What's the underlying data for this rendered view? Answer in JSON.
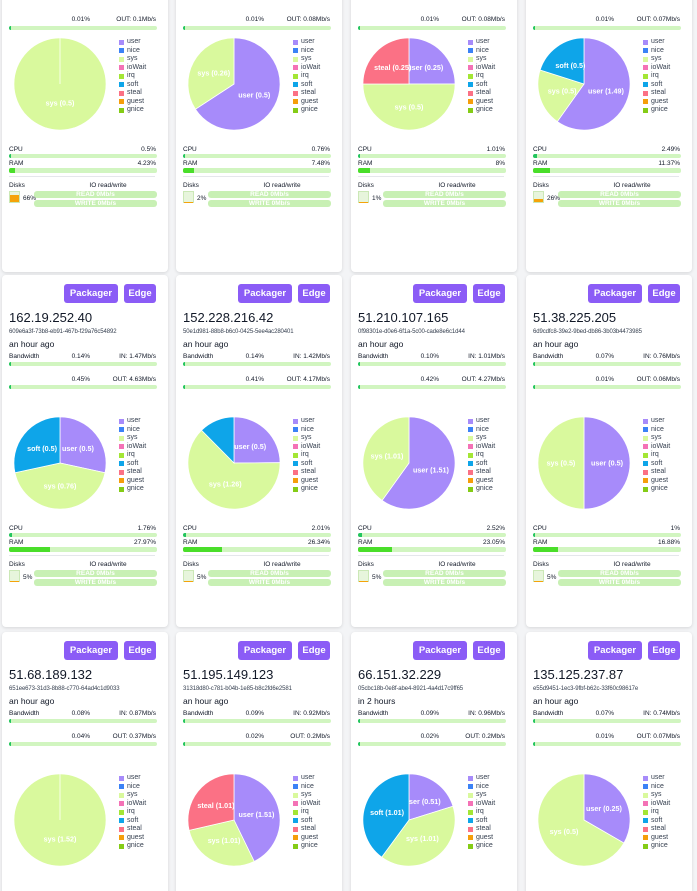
{
  "buttons": {
    "packager": "Packager",
    "edge": "Edge"
  },
  "labels": {
    "bandwidth": "Bandwidth",
    "cpu": "CPU",
    "ram": "RAM",
    "disks": "Disks",
    "io": "IO read/write",
    "read": "READ 0Mb/s",
    "write": "WRITE 0Mb/s"
  },
  "legend": [
    {
      "name": "user",
      "color": "#a78bfa"
    },
    {
      "name": "nice",
      "color": "#3b82f6"
    },
    {
      "name": "sys",
      "color": "#d9f99d"
    },
    {
      "name": "ioWait",
      "color": "#f472b6"
    },
    {
      "name": "irq",
      "color": "#a3e635"
    },
    {
      "name": "soft",
      "color": "#0ea5e9"
    },
    {
      "name": "steal",
      "color": "#fb7185"
    },
    {
      "name": "guest",
      "color": "#f59e0b"
    },
    {
      "name": "gnice",
      "color": "#84cc16"
    }
  ],
  "colors": {
    "user": "#a78bfa",
    "sys": "#d9f99d",
    "soft": "#0ea5e9",
    "steal": "#fb7185"
  },
  "rows": [
    {
      "cards": [
        {
          "out_pct": "0.01%",
          "out_val": "OUT: 0.1Mb/s",
          "out_frac": 0.0001,
          "cpu": "0.5%",
          "cpu_frac": 0.005,
          "ram": "4.23%",
          "ram_frac": 0.0423,
          "disk": "66%",
          "disk_frac": 0.66,
          "pie": [
            {
              "k": "sys",
              "v": 0.5,
              "label": "sys (0.5)"
            }
          ]
        },
        {
          "out_pct": "0.01%",
          "out_val": "OUT: 0.08Mb/s",
          "out_frac": 0.0001,
          "cpu": "0.76%",
          "cpu_frac": 0.0076,
          "ram": "7.48%",
          "ram_frac": 0.0748,
          "disk": "2%",
          "disk_frac": 0.02,
          "pie": [
            {
              "k": "user",
              "v": 0.5,
              "label": "user (0.5)"
            },
            {
              "k": "sys",
              "v": 0.26,
              "label": "sys (0.26)"
            }
          ]
        },
        {
          "out_pct": "0.01%",
          "out_val": "OUT: 0.08Mb/s",
          "out_frac": 0.0001,
          "cpu": "1.01%",
          "cpu_frac": 0.0101,
          "ram": "8%",
          "ram_frac": 0.08,
          "disk": "1%",
          "disk_frac": 0.01,
          "pie": [
            {
              "k": "user",
              "v": 0.25,
              "label": "user (0.25)"
            },
            {
              "k": "sys",
              "v": 0.5,
              "label": "sys (0.5)"
            },
            {
              "k": "steal",
              "v": 0.25,
              "label": "steal (0.25)"
            }
          ]
        },
        {
          "out_pct": "0.01%",
          "out_val": "OUT: 0.07Mb/s",
          "out_frac": 0.0001,
          "cpu": "2.49%",
          "cpu_frac": 0.0249,
          "ram": "11.37%",
          "ram_frac": 0.1137,
          "disk": "26%",
          "disk_frac": 0.26,
          "pie": [
            {
              "k": "user",
              "v": 1.49,
              "label": "user (1.49)"
            },
            {
              "k": "sys",
              "v": 0.5,
              "label": "sys (0.5)"
            },
            {
              "k": "soft",
              "v": 0.5,
              "label": "soft (0.5)"
            }
          ]
        }
      ]
    },
    {
      "cards": [
        {
          "ip": "162.19.252.40",
          "uuid": "609e6a3f-73b8-eb91-467b-f29a76c54892",
          "ago": "an hour ago",
          "bw_pct": "0.14%",
          "bw_frac": 0.0014,
          "in_val": "IN: 1.47Mb/s",
          "out_pct": "0.45%",
          "out_frac": 0.0045,
          "out_val": "OUT: 4.63Mb/s",
          "cpu": "1.76%",
          "cpu_frac": 0.0176,
          "ram": "27.97%",
          "ram_frac": 0.2797,
          "disk": "5%",
          "disk_frac": 0.05,
          "pie": [
            {
              "k": "user",
              "v": 0.5,
              "label": "user (0.5)"
            },
            {
              "k": "sys",
              "v": 0.76,
              "label": "sys (0.76)"
            },
            {
              "k": "soft",
              "v": 0.5,
              "label": "soft (0.5)"
            }
          ]
        },
        {
          "ip": "152.228.216.42",
          "uuid": "50e1d981-88b8-b6c0-0425-5ee4ac280401",
          "ago": "an hour ago",
          "bw_pct": "0.14%",
          "bw_frac": 0.0014,
          "in_val": "IN: 1.42Mb/s",
          "out_pct": "0.41%",
          "out_frac": 0.0041,
          "out_val": "OUT: 4.17Mb/s",
          "cpu": "2.01%",
          "cpu_frac": 0.0201,
          "ram": "26.34%",
          "ram_frac": 0.2634,
          "disk": "5%",
          "disk_frac": 0.05,
          "pie": [
            {
              "k": "user",
              "v": 0.5,
              "label": "user (0.5)"
            },
            {
              "k": "sys",
              "v": 1.26,
              "label": "sys (1.26)"
            },
            {
              "k": "soft",
              "v": 0.25,
              "label": ""
            }
          ]
        },
        {
          "ip": "51.210.107.165",
          "uuid": "0f98301e-d0e6-6f1a-5c00-cade8e6c1d44",
          "ago": "an hour ago",
          "bw_pct": "0.10%",
          "bw_frac": 0.001,
          "in_val": "IN: 1.01Mb/s",
          "out_pct": "0.42%",
          "out_frac": 0.0042,
          "out_val": "OUT: 4.27Mb/s",
          "cpu": "2.52%",
          "cpu_frac": 0.0252,
          "ram": "23.05%",
          "ram_frac": 0.2305,
          "disk": "5%",
          "disk_frac": 0.05,
          "pie": [
            {
              "k": "user",
              "v": 1.51,
              "label": "user (1.51)"
            },
            {
              "k": "sys",
              "v": 1.01,
              "label": "sys (1.01)"
            }
          ]
        },
        {
          "ip": "51.38.225.205",
          "uuid": "6d9cdfc8-39e2-9bed-db86-3b03b4473985",
          "ago": "an hour ago",
          "bw_pct": "0.07%",
          "bw_frac": 0.0007,
          "in_val": "IN: 0.76Mb/s",
          "out_pct": "0.01%",
          "out_frac": 0.0001,
          "out_val": "OUT: 0.06Mb/s",
          "cpu": "1%",
          "cpu_frac": 0.01,
          "ram": "16.88%",
          "ram_frac": 0.1688,
          "disk": "5%",
          "disk_frac": 0.05,
          "pie": [
            {
              "k": "user",
              "v": 0.5,
              "label": "user (0.5)"
            },
            {
              "k": "sys",
              "v": 0.5,
              "label": "sys (0.5)"
            }
          ]
        }
      ]
    },
    {
      "cards": [
        {
          "ip": "51.68.189.132",
          "uuid": "651ee673-31d3-8b88-c770-64ad4c1d9033",
          "ago": "an hour ago",
          "bw_pct": "0.08%",
          "bw_frac": 0.0008,
          "in_val": "IN: 0.87Mb/s",
          "out_pct": "0.04%",
          "out_frac": 0.0004,
          "out_val": "OUT: 0.37Mb/s",
          "pie": [
            {
              "k": "sys",
              "v": 1.52,
              "label": "sys (1.52)"
            }
          ]
        },
        {
          "ip": "51.195.149.123",
          "uuid": "31318d80-c781-b04b-1e85-b8c2fd6e2581",
          "ago": "an hour ago",
          "bw_pct": "0.09%",
          "bw_frac": 0.0009,
          "in_val": "IN: 0.92Mb/s",
          "out_pct": "0.02%",
          "out_frac": 0.0002,
          "out_val": "OUT: 0.2Mb/s",
          "pie": [
            {
              "k": "user",
              "v": 1.51,
              "label": "user (1.51)"
            },
            {
              "k": "sys",
              "v": 1.01,
              "label": "sys (1.01)"
            },
            {
              "k": "steal",
              "v": 1.01,
              "label": "steal (1.01)"
            }
          ]
        },
        {
          "ip": "66.151.32.229",
          "uuid": "05cbc18b-0e8f-abe4-8921-4a4d17c9ff65",
          "ago": "in 2 hours",
          "bw_pct": "0.09%",
          "bw_frac": 0.0009,
          "in_val": "IN: 0.96Mb/s",
          "out_pct": "0.02%",
          "out_frac": 0.0002,
          "out_val": "OUT: 0.2Mb/s",
          "pie": [
            {
              "k": "user",
              "v": 0.51,
              "label": "user (0.51)"
            },
            {
              "k": "sys",
              "v": 1.01,
              "label": "sys (1.01)"
            },
            {
              "k": "soft",
              "v": 1.01,
              "label": "soft (1.01)"
            }
          ]
        },
        {
          "ip": "135.125.237.87",
          "uuid": "e55d9451-1ec3-9fbf-b62c-33f60c98617e",
          "ago": "an hour ago",
          "bw_pct": "0.07%",
          "bw_frac": 0.0007,
          "in_val": "IN: 0.74Mb/s",
          "out_pct": "0.01%",
          "out_frac": 0.0001,
          "out_val": "OUT: 0.07Mb/s",
          "pie": [
            {
              "k": "user",
              "v": 0.25,
              "label": "user (0.25)"
            },
            {
              "k": "sys",
              "v": 0.5,
              "label": "sys (0.5)"
            }
          ]
        }
      ]
    }
  ]
}
